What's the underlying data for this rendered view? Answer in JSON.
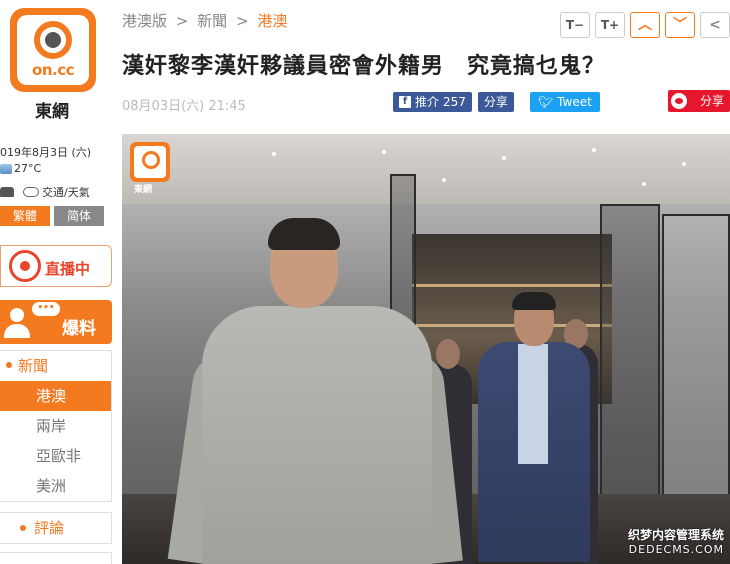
{
  "brand": {
    "logo_text": "on.cc",
    "name": "東網"
  },
  "sidebar": {
    "date": "019年8月3日 (六)",
    "temperature": "27°C",
    "traffic_label": "交通/天氣",
    "lang_traditional": "繁體",
    "lang_simplified": "简体",
    "live_label": "直播中",
    "tip_bubble": "•••",
    "tip_label": "爆料",
    "nav_head": "新聞",
    "nav_items": [
      "港澳",
      "兩岸",
      "亞歐非",
      "美洲"
    ],
    "nav_active_index": 0,
    "comment_label": "評論"
  },
  "breadcrumb": {
    "section": "港澳版",
    "category": "新聞",
    "current": "港澳",
    "separator": ">"
  },
  "tools": {
    "font_smaller": "T−",
    "font_larger": "T+",
    "up": "︿",
    "down": "﹀",
    "back": "<"
  },
  "article": {
    "title": "漢奸黎李漢奸夥議員密會外籍男　究竟搞乜鬼？",
    "published": "08月03日(六) 21:45"
  },
  "share": {
    "fb_like_label": "推介",
    "fb_like_count": "257",
    "fb_share_label": "分享",
    "tweet_label": "Tweet",
    "weibo_label": "分享"
  },
  "photo": {
    "logo_name": "東網",
    "watermark_line1": "织梦内容管理系统",
    "watermark_line2": "DEDECMS.COM"
  },
  "colors": {
    "accent": "#f47a20",
    "facebook": "#3b5998",
    "twitter": "#1da1f2",
    "weibo": "#e6162d"
  }
}
